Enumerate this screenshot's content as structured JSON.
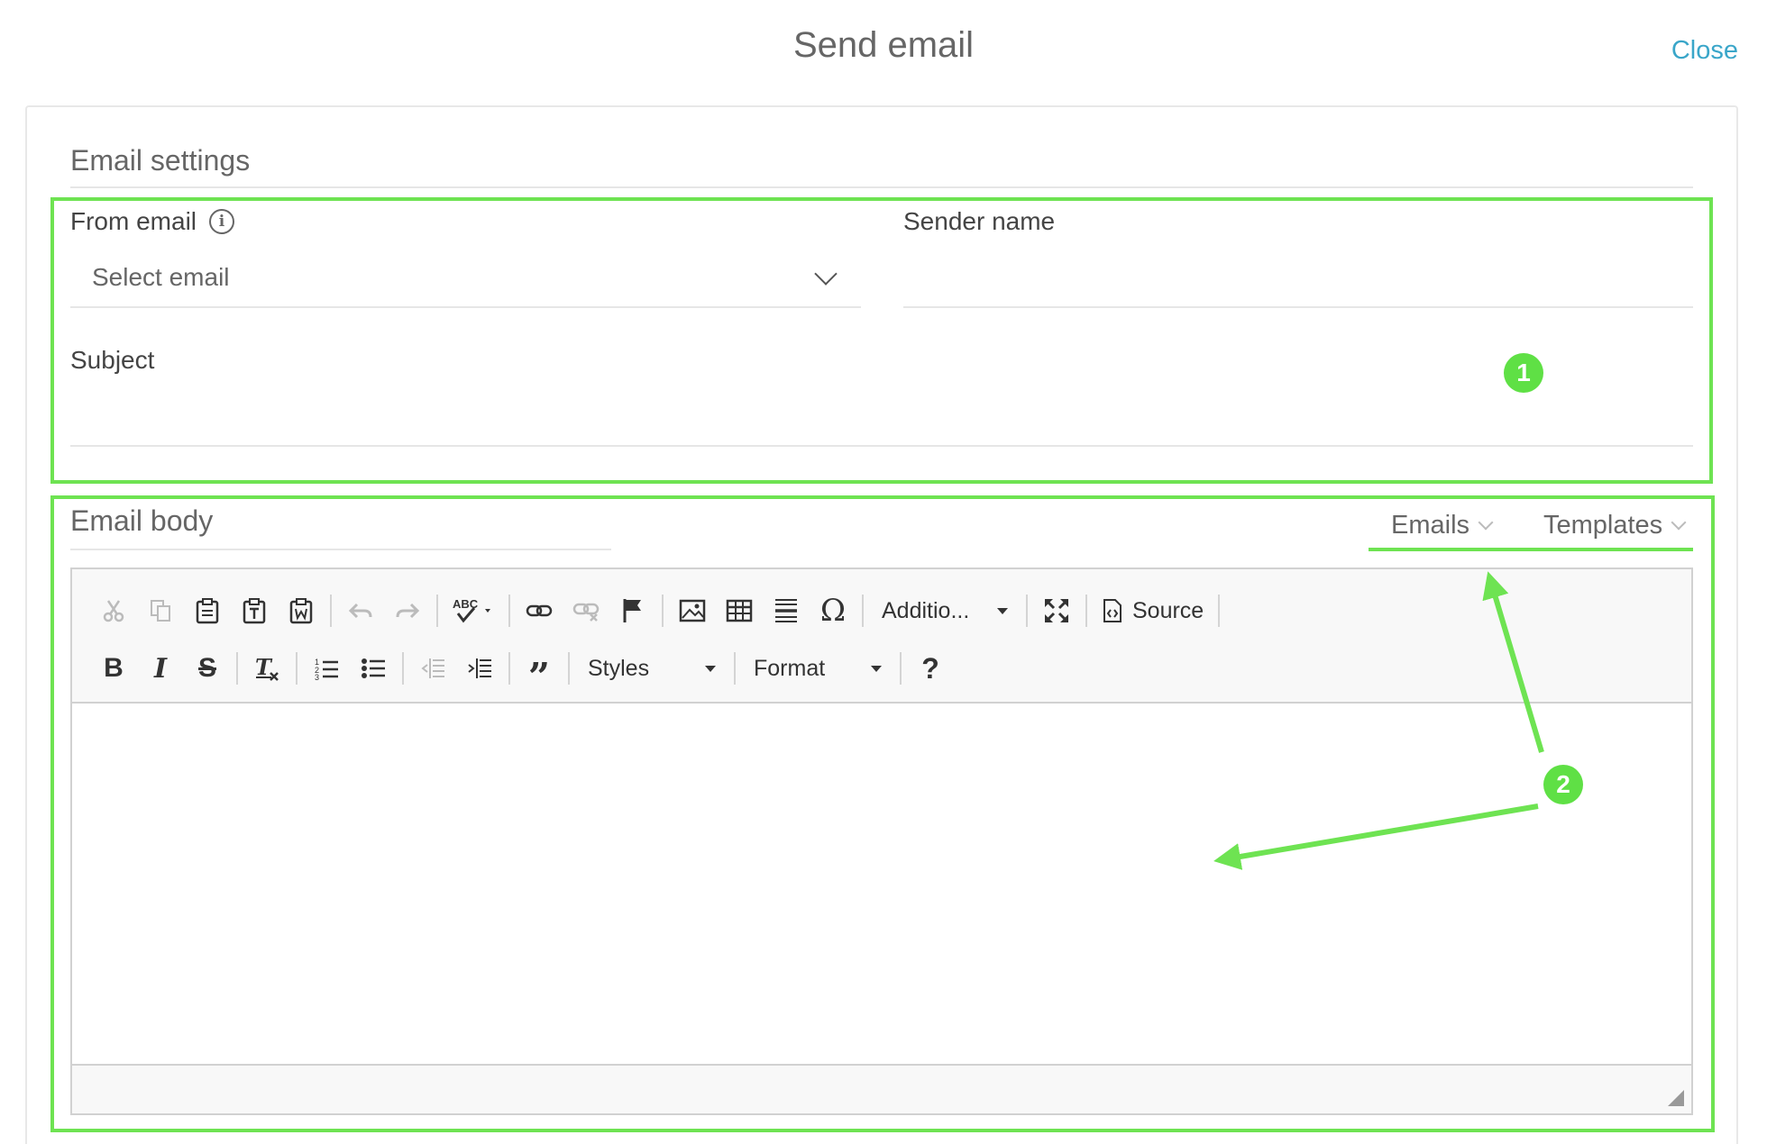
{
  "header": {
    "title": "Send email",
    "close_label": "Close"
  },
  "settings": {
    "section_title": "Email settings",
    "from_email": {
      "label": "From email",
      "placeholder": "Select email"
    },
    "sender_name": {
      "label": "Sender name",
      "value": ""
    },
    "subject": {
      "label": "Subject",
      "value": ""
    }
  },
  "body": {
    "section_title": "Email body",
    "tabs": [
      {
        "label": "Emails"
      },
      {
        "label": "Templates"
      }
    ]
  },
  "toolbar": {
    "row1": [
      {
        "icon": "cut-icon",
        "enabled": false
      },
      {
        "icon": "copy-icon",
        "enabled": false
      },
      {
        "icon": "paste-icon",
        "enabled": true
      },
      {
        "icon": "paste-text-icon",
        "enabled": true
      },
      {
        "icon": "paste-from-word-icon",
        "enabled": true
      },
      {
        "icon": "undo-icon",
        "enabled": false
      },
      {
        "icon": "redo-icon",
        "enabled": false
      },
      {
        "icon": "spellcheck-icon",
        "enabled": true
      },
      {
        "icon": "link-icon",
        "enabled": true
      },
      {
        "icon": "unlink-icon",
        "enabled": false
      },
      {
        "icon": "anchor-icon",
        "enabled": true
      },
      {
        "icon": "image-icon",
        "enabled": true
      },
      {
        "icon": "table-icon",
        "enabled": true
      },
      {
        "icon": "horizontal-rule-icon",
        "enabled": true
      },
      {
        "icon": "special-char-icon",
        "enabled": true
      }
    ],
    "additional_label": "Additio...",
    "maximize_icon": "maximize-icon",
    "source_label": "Source",
    "styles_label": "Styles",
    "format_label": "Format",
    "help_label": "?"
  },
  "annotations": {
    "badge_1": "1",
    "badge_2": "2",
    "color": "#6ee352"
  }
}
